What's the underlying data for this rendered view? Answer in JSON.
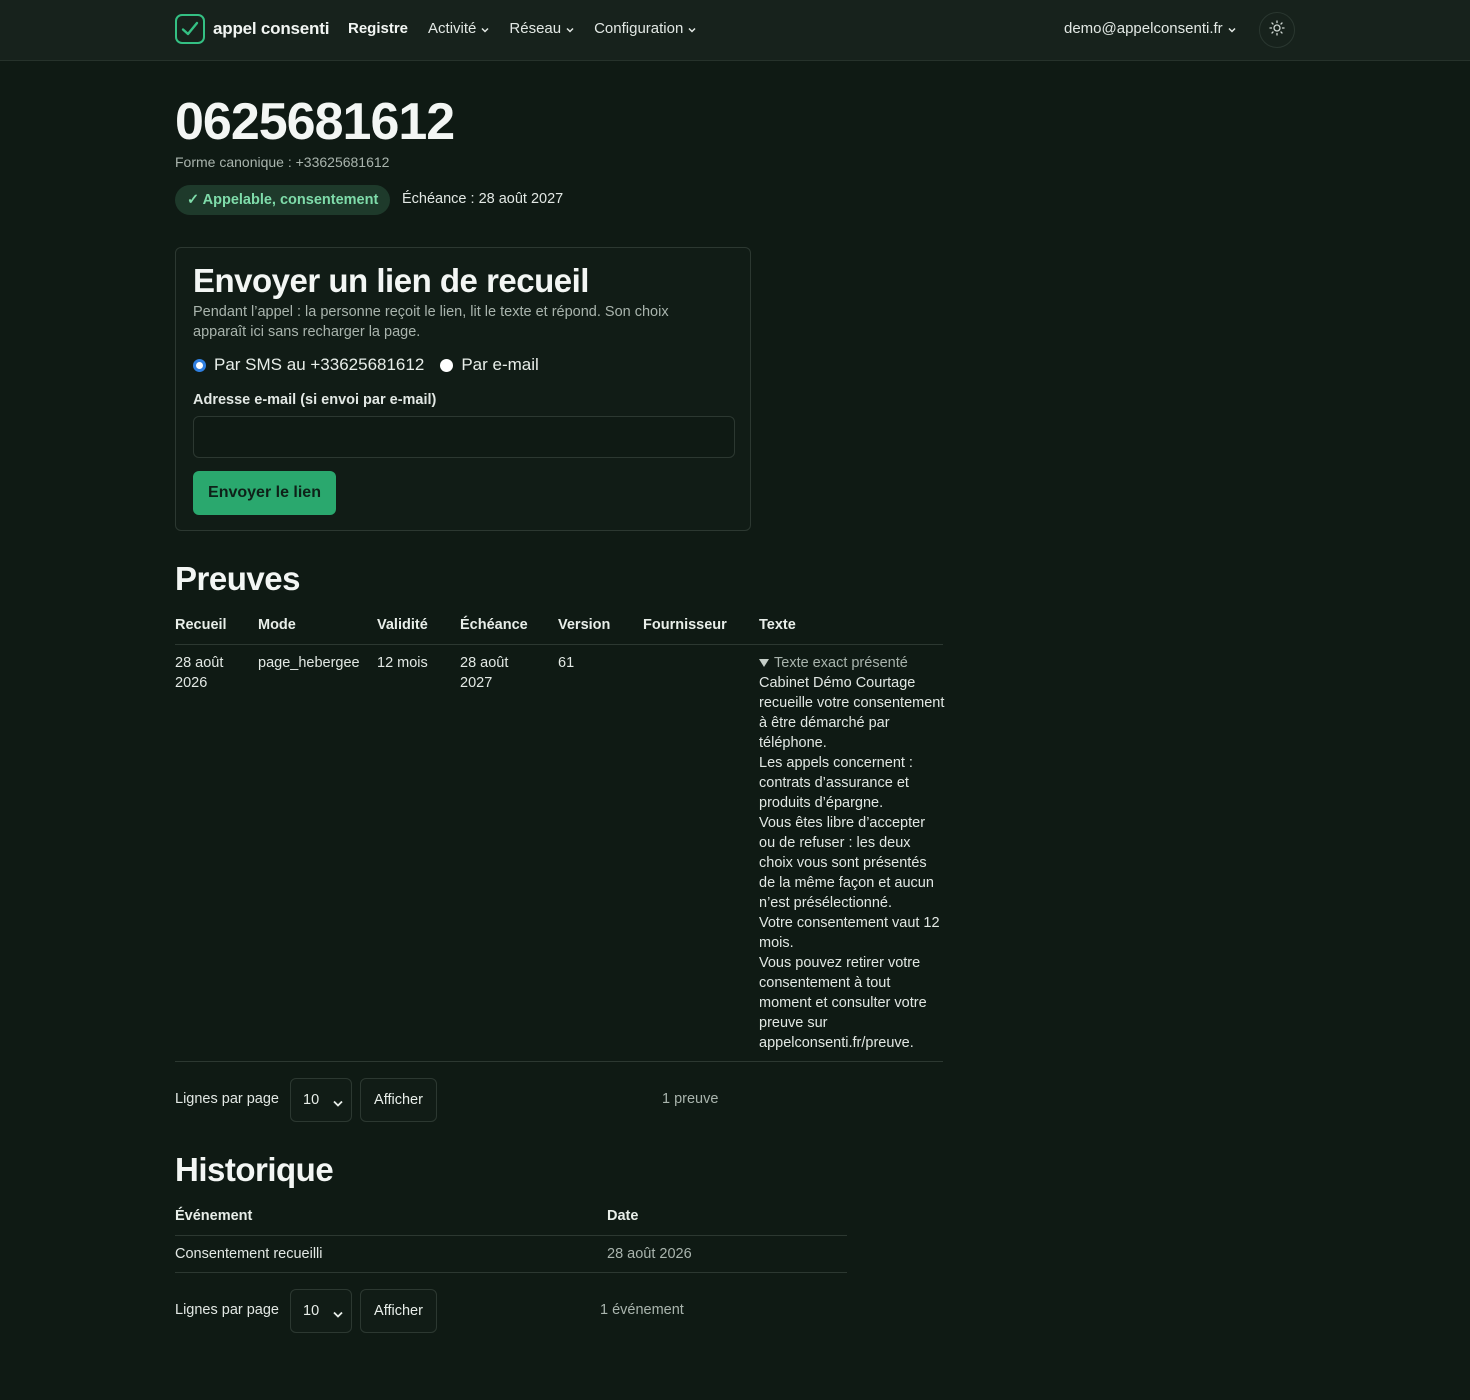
{
  "header": {
    "brand": "appel consenti",
    "nav": [
      {
        "label": "Registre",
        "dropdown": false
      },
      {
        "label": "Activité",
        "dropdown": true
      },
      {
        "label": "Réseau",
        "dropdown": true
      },
      {
        "label": "Configuration",
        "dropdown": true
      }
    ],
    "user_email": "demo@appelconsenti.fr"
  },
  "page": {
    "title": "0625681612",
    "canonical": "Forme canonique : +33625681612",
    "status_badge": "✓ Appelable, consentement",
    "expiry": "Échéance : 28 août 2027"
  },
  "send_card": {
    "title": "Envoyer un lien de recueil",
    "description": "Pendant l’appel : la personne reçoit le lien, lit le texte et répond. Son choix apparaît ici sans recharger la page.",
    "radio_sms": "Par SMS au +33625681612",
    "radio_email": "Par e-mail",
    "email_label": "Adresse e-mail (si envoi par e-mail)",
    "email_value": "",
    "email_placeholder": "",
    "send_button": "Envoyer le lien"
  },
  "proofs": {
    "title": "Preuves",
    "columns": [
      "Recueil",
      "Mode",
      "Validité",
      "Échéance",
      "Version",
      "Fournisseur",
      "Texte"
    ],
    "row": {
      "recueil": "28 août 2026",
      "mode": "page_hebergee",
      "validite": "12 mois",
      "echeance": "28 août 2027",
      "version": "61",
      "fournisseur": "",
      "summary": "Texte exact présenté",
      "text_lines": [
        "Cabinet Démo Courtage recueille votre consentement à être démarché par téléphone.",
        "Les appels concernent : contrats d’assurance et produits d’épargne.",
        "Vous êtes libre d’accepter ou de refuser : les deux choix vous sont présentés de la même façon et aucun n’est présélectionné.",
        "Votre consentement vaut 12 mois.",
        "Vous pouvez retirer votre consentement à tout moment et consulter votre preuve sur appelconsenti.fr/preuve."
      ]
    },
    "pager": {
      "label": "Lignes par page",
      "value": "10",
      "button": "Afficher",
      "count": "1 preuve"
    }
  },
  "history": {
    "title": "Historique",
    "columns": [
      "Événement",
      "Date"
    ],
    "row": {
      "event": "Consentement recueilli",
      "date": "28 août 2026"
    },
    "pager": {
      "label": "Lignes par page",
      "value": "10",
      "button": "Afficher",
      "count": "1 événement"
    }
  }
}
